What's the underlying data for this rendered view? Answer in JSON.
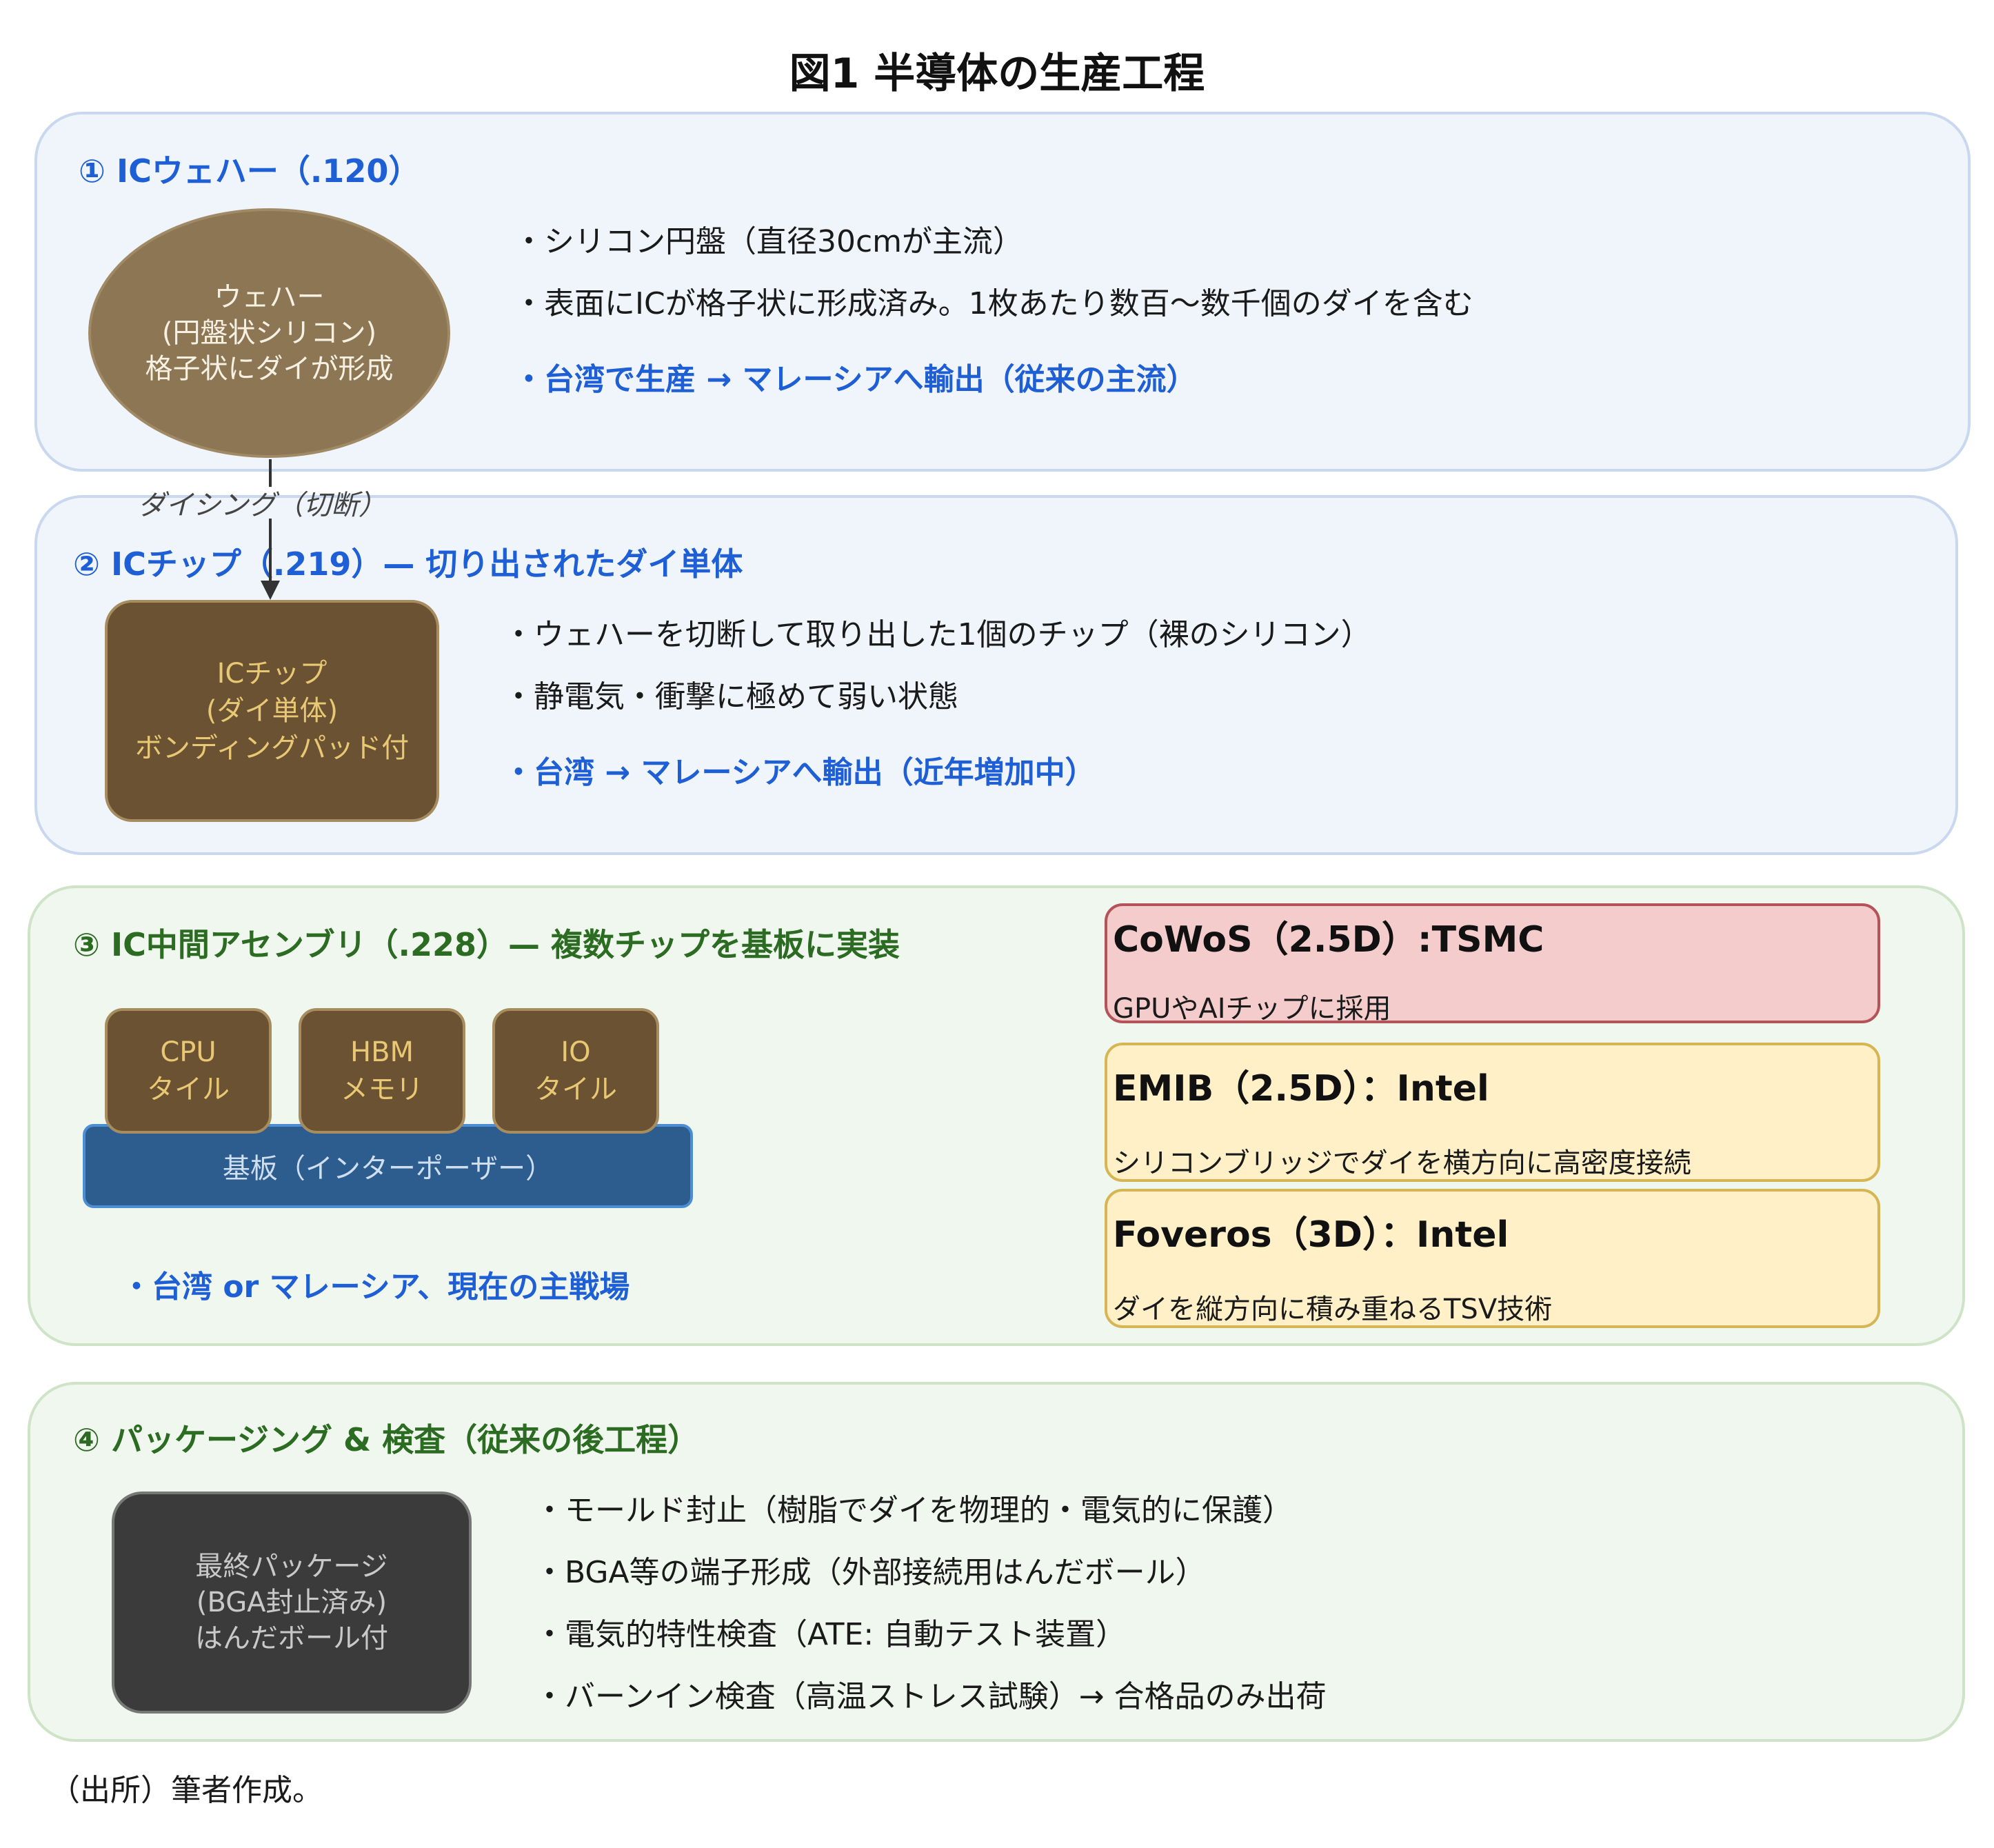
{
  "title": "図1 半導体の生産工程",
  "stage1": {
    "heading": "① ICウェハー（.120）",
    "wafer_lines": [
      "ウェハー",
      "(円盤状シリコン)",
      "格子状にダイが形成"
    ],
    "bullets": [
      "・シリコン円盤（直径30cmが主流）",
      "・表面にICが格子状に形成済み。1枚あたり数百〜数千個のダイを含む"
    ],
    "flow": "・台湾で生産 → マレーシアへ輸出（従来の主流）"
  },
  "dicing_label": "ダイシング（切断）",
  "stage2": {
    "heading": "② ICチップ（.219）— 切り出されたダイ単体",
    "chip_lines": [
      "ICチップ",
      "(ダイ単体)",
      "ボンディングパッド付"
    ],
    "bullets": [
      "・ウェハーを切断して取り出した1個のチップ（裸のシリコン）",
      "・静電気・衝撃に極めて弱い状態"
    ],
    "flow": "・台湾 → マレーシアへ輸出（近年増加中）"
  },
  "stage3": {
    "heading": "③ IC中間アセンブリ（.228）— 複数チップを基板に実装",
    "tiles": [
      {
        "line1": "CPU",
        "line2": "タイル"
      },
      {
        "line1": "HBM",
        "line2": "メモリ"
      },
      {
        "line1": "IO",
        "line2": "タイル"
      }
    ],
    "substrate": "基板（インターポーザー）",
    "flow": "・台湾 or マレーシア、現在の主戦場",
    "technologies": [
      {
        "title": "CoWoS（2.5D）:TSMC",
        "desc": "GPUやAIチップに採用",
        "fill": "#f5cccc",
        "border": "#b5535a"
      },
      {
        "title": "EMIB（2.5D）：Intel",
        "desc": "シリコンブリッジでダイを横方向に高密度接続",
        "fill": "#fff0c8",
        "border": "#d6b654"
      },
      {
        "title": "Foveros（3D）：Intel",
        "desc": "ダイを縦方向に積み重ねるTSV技術",
        "fill": "#fff0c8",
        "border": "#d6b654"
      }
    ]
  },
  "stage4": {
    "heading": "④ パッケージング & 検査（従来の後工程）",
    "package_lines": [
      "最終パッケージ",
      "(BGA封止済み)",
      "はんだボール付"
    ],
    "bullets": [
      "・モールド封止（樹脂でダイを物理的・電気的に保護）",
      "・BGA等の端子形成（外部接続用はんだボール）",
      "・電気的特性検査（ATE: 自動テスト装置）",
      "・バーンイン検査（高温ストレス試験）→ 合格品のみ出荷"
    ]
  },
  "source": "（出所）筆者作成。"
}
